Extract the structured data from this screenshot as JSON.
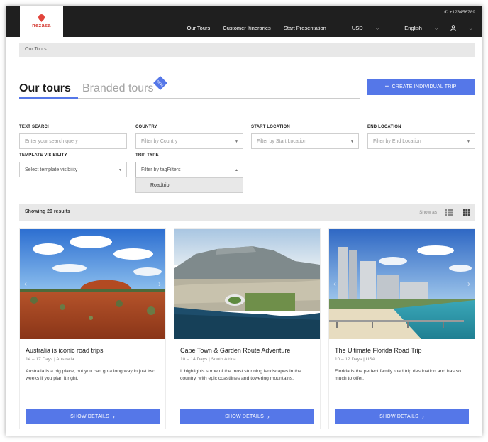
{
  "header": {
    "logo": "nezasa",
    "phone": "+123456789",
    "nav": [
      {
        "label": "Our Tours"
      },
      {
        "label": "Customer Itineraries"
      },
      {
        "label": "Start Presentation"
      },
      {
        "label": "USD"
      },
      {
        "label": "English"
      }
    ]
  },
  "breadcrumb": "Our Tours",
  "tabs": {
    "active": "Our tours",
    "inactive": "Branded tours",
    "badge": "NEW"
  },
  "create_button": "CREATE INDIVIDUAL TRIP",
  "filters": {
    "text_search": {
      "label": "TEXT SEARCH",
      "placeholder": "Enter your search query"
    },
    "country": {
      "label": "COUNTRY",
      "placeholder": "Filter by Country"
    },
    "start_location": {
      "label": "START LOCATION",
      "placeholder": "Filter by Start Location"
    },
    "end_location": {
      "label": "END LOCATION",
      "placeholder": "Filter by End Location"
    },
    "template_visibility": {
      "label": "TEMPLATE VISIBILITY",
      "placeholder": "Select template visibility"
    },
    "trip_type": {
      "label": "TRIP TYPE",
      "placeholder": "Filter by tagFilters",
      "options": [
        "Roadtrip"
      ]
    }
  },
  "results": {
    "count_text": "Showing 20 results",
    "show_as": "Show as"
  },
  "cards": [
    {
      "title": "Australia is iconic road trips",
      "meta": "14 – 17 Days | Australia",
      "description": "Australia is a big place, but you can go a long way in just two weeks if you plan it right.",
      "button": "SHOW DETAILS"
    },
    {
      "title": "Cape Town & Garden Route Adventure",
      "meta": "10 – 14 Days | South Africa",
      "description": "It highlights some of the most stunning landscapes in the country, with epic coastlines and towering mountains.",
      "button": "SHOW DETAILS"
    },
    {
      "title": "The Ultimate Florida Road Trip",
      "meta": "10 – 12 Days | USA",
      "description": "Florida is the perfect family road trip destination and has so much to offer.",
      "button": "SHOW DETAILS"
    }
  ],
  "colors": {
    "accent": "#5577e8",
    "header_bg": "#1f1f1f",
    "brand": "#d43b33"
  }
}
